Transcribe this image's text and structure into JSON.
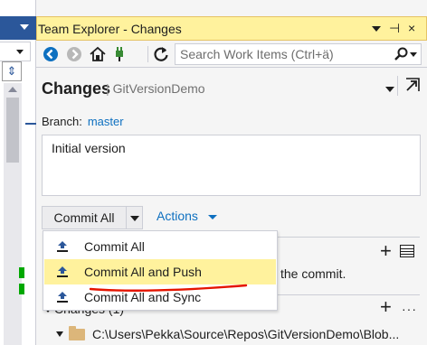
{
  "window": {
    "title": "Team Explorer - Changes",
    "controls": [
      "▾",
      "⊣",
      "×"
    ]
  },
  "toolbar": {
    "icons": [
      "back-icon",
      "forward-icon",
      "home-icon",
      "connect-icon",
      "refresh-icon"
    ],
    "search_placeholder": "Search Work Items (Ctrl+ä)"
  },
  "header": {
    "title": "Changes",
    "subtitle": "GitVersionDemo"
  },
  "branch": {
    "label": "Branch:",
    "name": "master"
  },
  "commit_message": "Initial version",
  "commit": {
    "button_label": "Commit All",
    "actions_label": "Actions"
  },
  "menu": {
    "items": [
      {
        "label": "Commit All"
      },
      {
        "label": "Commit All and Push"
      },
      {
        "label": "Commit All and Sync"
      }
    ],
    "highlighted_index": 1
  },
  "background": {
    "commit_hint_fragment": "the commit.",
    "changes_header_fragment": "Changes (1)",
    "path": "C:\\Users\\Pekka\\Source\\Repos\\GitVersionDemo\\Blob..."
  },
  "colors": {
    "accent_blue": "#0e70c0",
    "highlight_yellow": "#fff29d",
    "editor_blue": "#2b579a",
    "annotation_red": "#e51400",
    "change_green": "#00a800"
  }
}
